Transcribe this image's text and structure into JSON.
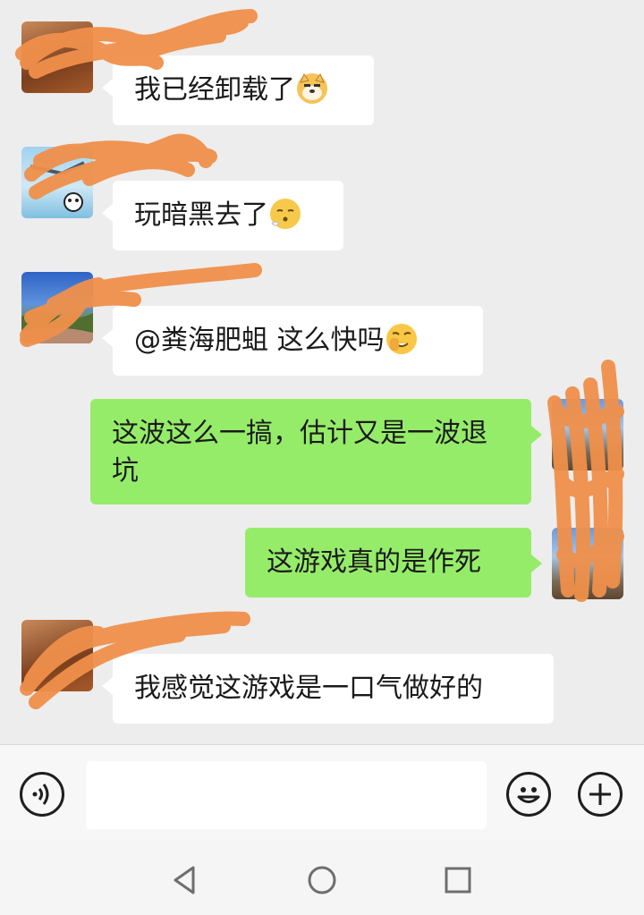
{
  "messages": [
    {
      "sender": "other",
      "name": "",
      "text": "我已经卸载了",
      "emoji": "doge-emoji"
    },
    {
      "sender": "other",
      "name": "",
      "text": "玩暗黑去了",
      "emoji": "sighing-emoji"
    },
    {
      "sender": "other",
      "name": "",
      "text": "@粪海肥蛆  这么快吗",
      "emoji": "facepalm-emoji"
    },
    {
      "sender": "self",
      "text": "这波这么一搞，估计又是一波退坑"
    },
    {
      "sender": "self",
      "text": "这游戏真的是作死"
    },
    {
      "sender": "other",
      "name": "",
      "text": "我感觉这游戏是一口气做好的"
    }
  ],
  "input": {
    "value": "",
    "placeholder": ""
  },
  "icons": {
    "voice": "voice-input-icon",
    "emoji": "emoji-picker-icon",
    "more": "plus-icon",
    "back": "nav-back-icon",
    "home": "nav-home-icon",
    "recents": "nav-recents-icon"
  },
  "colors": {
    "background": "#ededed",
    "incoming_bubble": "#ffffff",
    "outgoing_bubble": "#95ec69",
    "redaction": "#f0904b"
  }
}
